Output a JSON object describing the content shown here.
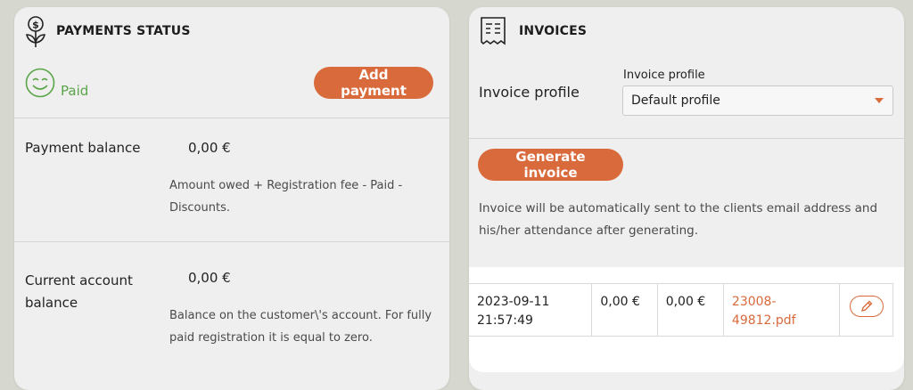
{
  "payments": {
    "title": "PAYMENTS STATUS",
    "status_label": "Paid",
    "add_payment_label": "Add payment",
    "balance_label": "Payment balance",
    "balance_value": "0,00 €",
    "balance_desc_line1": "Amount owed + Registration fee - Paid -",
    "balance_desc_line2": "Discounts.",
    "current_label_line1": "Current account",
    "current_label_line2": "balance",
    "current_value": "0,00 €",
    "current_desc_line1": "Balance on the customer\\'s account. For fully",
    "current_desc_line2": "paid registration it is equal to zero."
  },
  "invoices": {
    "title": "INVOICES",
    "profile_label": "Invoice profile",
    "profile_field_label": "Invoice profile",
    "profile_selected": "Default profile",
    "generate_label": "Generate invoice",
    "info_line1": "Invoice will be automatically sent to the clients email address and",
    "info_line2": "his/her attendance after generating.",
    "rows": [
      {
        "date_line1": "2023-09-11",
        "date_line2": "21:57:49",
        "amount1": "0,00 €",
        "amount2": "0,00 €",
        "file_line1": "23008-",
        "file_line2": "49812.pdf"
      }
    ]
  },
  "colors": {
    "accent": "#d96a3b",
    "paid_green": "#5aa548",
    "card_bg": "#efefef"
  },
  "icons": {
    "payments": "money-plant-icon",
    "invoices": "receipt-icon",
    "status": "smile-icon",
    "edit": "pencil-icon"
  }
}
